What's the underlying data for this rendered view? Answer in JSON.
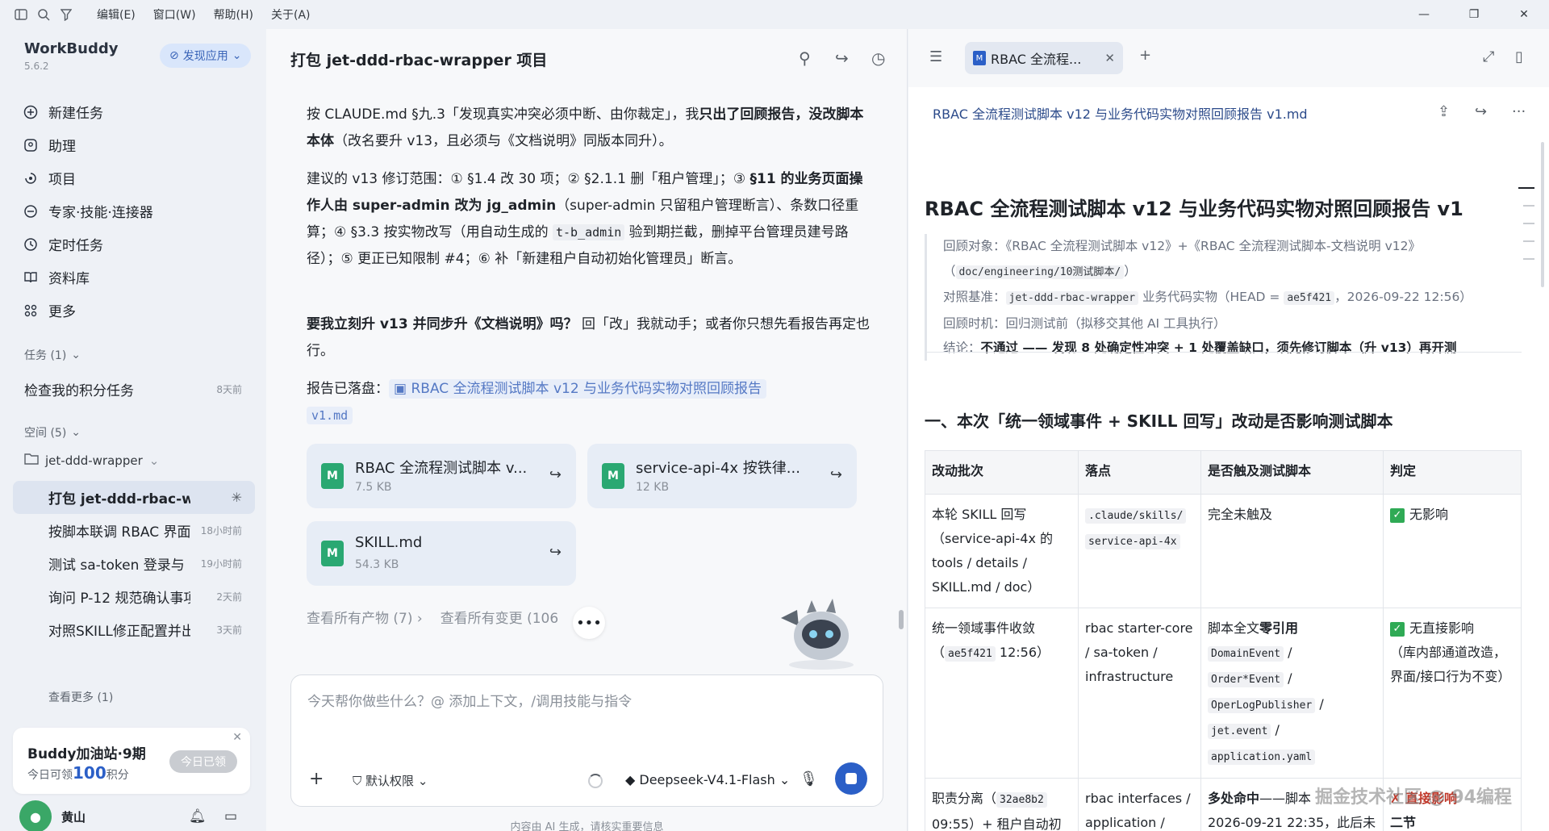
{
  "menu": {
    "edit": "编辑(E)",
    "window": "窗口(W)",
    "help": "帮助(H)",
    "about": "关于(A)"
  },
  "app": {
    "name": "WorkBuddy",
    "version": "5.6.2",
    "discover": "发现应用"
  },
  "nav": [
    {
      "label": "新建任务",
      "icon": "new-task-icon"
    },
    {
      "label": "助理",
      "icon": "assistant-icon"
    },
    {
      "label": "项目",
      "icon": "project-icon"
    },
    {
      "label": "专家·技能·连接器",
      "icon": "expert-icon"
    },
    {
      "label": "定时任务",
      "icon": "clock-icon"
    },
    {
      "label": "资料库",
      "icon": "book-icon"
    },
    {
      "label": "更多",
      "icon": "more-grid-icon"
    }
  ],
  "tasks": {
    "header": "任务 (1)",
    "items": [
      {
        "title": "检查我的积分任务",
        "time": "8天前"
      }
    ]
  },
  "spaces": {
    "header": "空间 (5)",
    "folder": "jet-ddd-wrapper",
    "items": [
      {
        "title": "打包 jet-ddd-rbac-wrapper",
        "time": ""
      },
      {
        "title": "按脚本联调 RBAC 界面",
        "time": "18小时前"
      },
      {
        "title": "测试 sa-token 登录与",
        "time": "19小时前"
      },
      {
        "title": "询问 P-12 规范确认事项",
        "time": "2天前"
      },
      {
        "title": "对照SKILL修正配置并出报",
        "time": "3天前"
      }
    ],
    "see_more": "查看更多 (1)"
  },
  "promo": {
    "title": "Buddy加油站·9期",
    "sub_prefix": "今日可领",
    "points": "100",
    "sub_suffix": "积分",
    "claim": "今日已领"
  },
  "user": {
    "name": "黄山"
  },
  "chat": {
    "title": "打包 jet-ddd-rbac-wrapper 项目",
    "p1a": "按 CLAUDE.md §九.3「发现真实冲突必须中断、由你裁定」，我",
    "p1b": "只出了回顾报告，没改脚本本体",
    "p1c": "（改名要升 v13，且必须与《文档说明》同版本同升）。",
    "p2a": "建议的 v13 修订范围：① §1.4 改 30 项；② §2.1.1 删「租户管理」；③ ",
    "p2b": "§11 的业务页面操作人由 super-admin 改为 jg_admin",
    "p2c": "（super-admin 只留租户管理断言）、条数口径重算；④ §3.3 按实物改写（用自动生成的 ",
    "p2code": "t-b_admin",
    "p2d": " 验到期拦截，删掉平台管理员建号路径）；⑤ 更正已知限制 #4；⑥ 补「新建租户自动初始化管理员」断言。",
    "p3a": "要我立刻升 v13 并同步升《文档说明》吗？",
    "p3b": " 回「改」我就动手；或者你只想先看报告再定也行。",
    "p4label": "报告已落盘：",
    "p4ref": "RBAC 全流程测试脚本 v12 与业务代码实物对照回顾报告",
    "p4ref2": "v1.md",
    "cards": [
      {
        "name": "RBAC 全流程测试脚本 v...",
        "size": "7.5 KB"
      },
      {
        "name": "service-api-4x 按铁律...",
        "size": "12 KB"
      },
      {
        "name": "SKILL.md",
        "size": "54.3 KB"
      }
    ],
    "link_products": "查看所有产物 (7)",
    "link_changes": "查看所有变更 (106",
    "input_placeholder": "今天帮你做些什么？@ 添加上下文，/调用技能与指令",
    "permission": "默认权限",
    "model": "Deepseek-V4.1-Flash",
    "disclaimer": "内容由 AI 生成，请核实重要信息"
  },
  "doc": {
    "tab": "RBAC 全流程...",
    "filename": "RBAC 全流程测试脚本 v12 与业务代码实物对照回顾报告 v1.md",
    "h1": "RBAC 全流程测试脚本 v12 与业务代码实物对照回顾报告 v1",
    "meta": {
      "l1_label": "回顾对象：",
      "l1_val": "《RBAC 全流程测试脚本 v12》+《RBAC 全流程测试脚本-文档说明 v12》",
      "l1_path": "doc/engineering/10测试脚本/",
      "l2_label": "对照基准：",
      "l2_code": "jet-ddd-rbac-wrapper",
      "l2_mid": " 业务代码实物（HEAD = ",
      "l2_hash": "ae5f421",
      "l2_end": "，2026-09-22 12:56）",
      "l3_label": "回顾时机：",
      "l3_val": "回归测试前（拟移交其他 AI 工具执行）",
      "l4_label": "结论：",
      "l4_val": "不通过 —— 发现 8 处确定性冲突 + 1 处覆盖缺口，须先修订脚本（升 v13）再开测"
    },
    "h2": "一、本次「统一领域事件 + SKILL 回写」改动是否影响测试脚本",
    "table": {
      "headers": [
        "改动批次",
        "落点",
        "是否触及测试脚本",
        "判定"
      ],
      "r1c1": "本轮 SKILL 回写（service-api-4x 的 tools / details / SKILL.md / doc）",
      "r1c2a": ".claude/skills/",
      "r1c2b": "service-api-4x",
      "r1c3": "完全未触及",
      "r1c4": "无影响",
      "r2c1a": "统一领域事件收敛（",
      "r2c1code": "ae5f421",
      "r2c1b": " 12:56）",
      "r2c2": "rbac starter-core / sa-token / infrastructure",
      "r2c3a": "脚本全文",
      "r2c3b": "零引用",
      "r2c3codes": [
        "DomainEvent",
        "Order*Event",
        "OperLogPublisher",
        "jet.event",
        "application.yaml"
      ],
      "r2c4a": "无直接影响",
      "r2c4b": "（库内部通道改造，界面/接口行为不变）",
      "r3c1a": "职责分离（",
      "r3c1code": "32ae8b2",
      "r3c1b": " 09:55）+ 租户自动初",
      "r3c2": "rbac interfaces / application /",
      "r3c3a": "多处命中",
      "r3c3b": "——脚本",
      "r3c3c": "2026-09-21 22:35，此后未",
      "r3c4a": "✗ 直接影响",
      "r3c4b": "二节"
    }
  },
  "watermark": "掘金技术社区 @ 94编程"
}
